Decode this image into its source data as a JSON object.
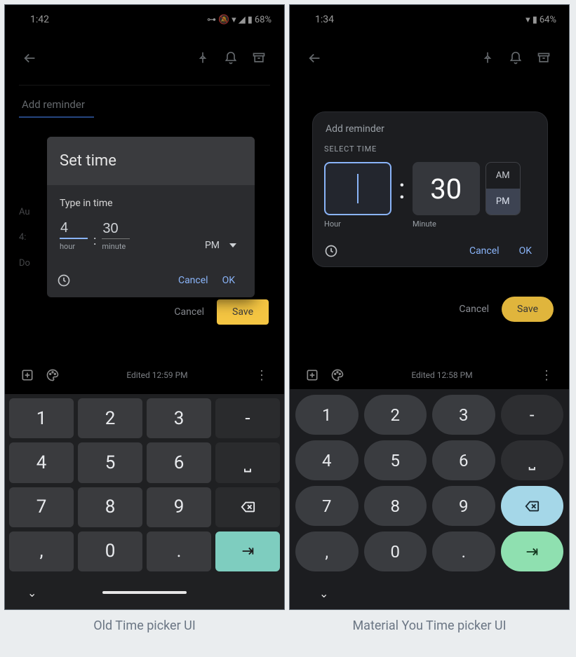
{
  "left": {
    "caption": "Old Time picker UI",
    "status": {
      "time": "1:42",
      "battery": "68%"
    },
    "page": {
      "add_reminder": "Add reminder",
      "left_col": [
        "Au",
        "4:",
        "Do"
      ]
    },
    "dialog": {
      "title": "Set time",
      "subtitle": "Type in time",
      "hour": "4",
      "minute": "30",
      "hour_label": "hour",
      "minute_label": "minute",
      "ampm": "PM",
      "cancel": "Cancel",
      "ok": "OK"
    },
    "behind": {
      "cancel": "Cancel",
      "save": "Save"
    },
    "editor": {
      "edited": "Edited 12:59 PM"
    },
    "keyboard": {
      "rows": [
        [
          "1",
          "2",
          "3",
          "-"
        ],
        [
          "4",
          "5",
          "6",
          "␣"
        ],
        [
          "7",
          "8",
          "9",
          "⌫"
        ],
        [
          ",",
          "0",
          ".",
          "⇥"
        ]
      ]
    }
  },
  "right": {
    "caption": "Material You Time picker UI",
    "status": {
      "time": "1:34",
      "battery": "64%"
    },
    "dialog": {
      "add_reminder": "Add reminder",
      "select_time": "SELECT TIME",
      "hour": "",
      "minute": "30",
      "hour_label": "Hour",
      "minute_label": "Minute",
      "am": "AM",
      "pm": "PM",
      "cancel": "Cancel",
      "ok": "OK"
    },
    "behind": {
      "cancel": "Cancel",
      "save": "Save"
    },
    "editor": {
      "edited": "Edited 12:58 PM"
    },
    "keyboard": {
      "rows": [
        [
          "1",
          "2",
          "3",
          "-"
        ],
        [
          "4",
          "5",
          "6",
          "␣"
        ],
        [
          "7",
          "8",
          "9",
          "⌫"
        ],
        [
          ",",
          "0",
          ".",
          "⇥"
        ]
      ]
    }
  }
}
